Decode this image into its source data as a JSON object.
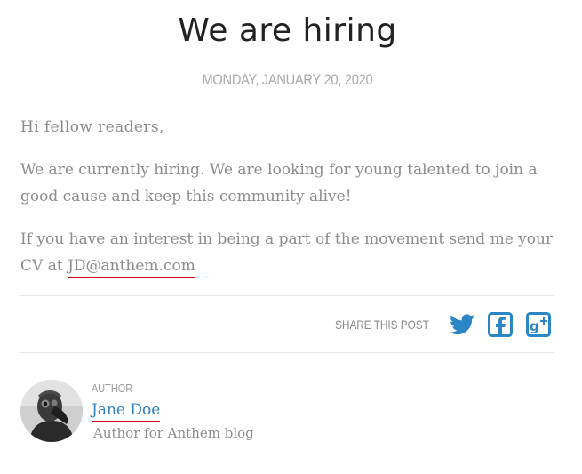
{
  "post": {
    "title": "We are hiring",
    "date": "MONDAY, JANUARY 20, 2020",
    "paragraphs": {
      "greeting": "Hi fellow readers,",
      "body": "We are currently hiring. We are looking for young talented to join a good cause and keep this community alive!",
      "cv_prefix": "If you have an interest in being a part of the movement send me your CV at ",
      "email": "JD@anthem.com"
    }
  },
  "share": {
    "label": "SHARE THIS POST",
    "icons": [
      "twitter-icon",
      "facebook-icon",
      "google-plus-icon"
    ]
  },
  "author": {
    "label": "AUTHOR",
    "name": "Jane Doe",
    "description": "Author for Anthem blog"
  },
  "colors": {
    "title": "#222222",
    "body_text": "#8c8c8c",
    "link_underline": "#d0021b",
    "author_name": "#2f80c0",
    "social_icon": "#2b86c5"
  }
}
